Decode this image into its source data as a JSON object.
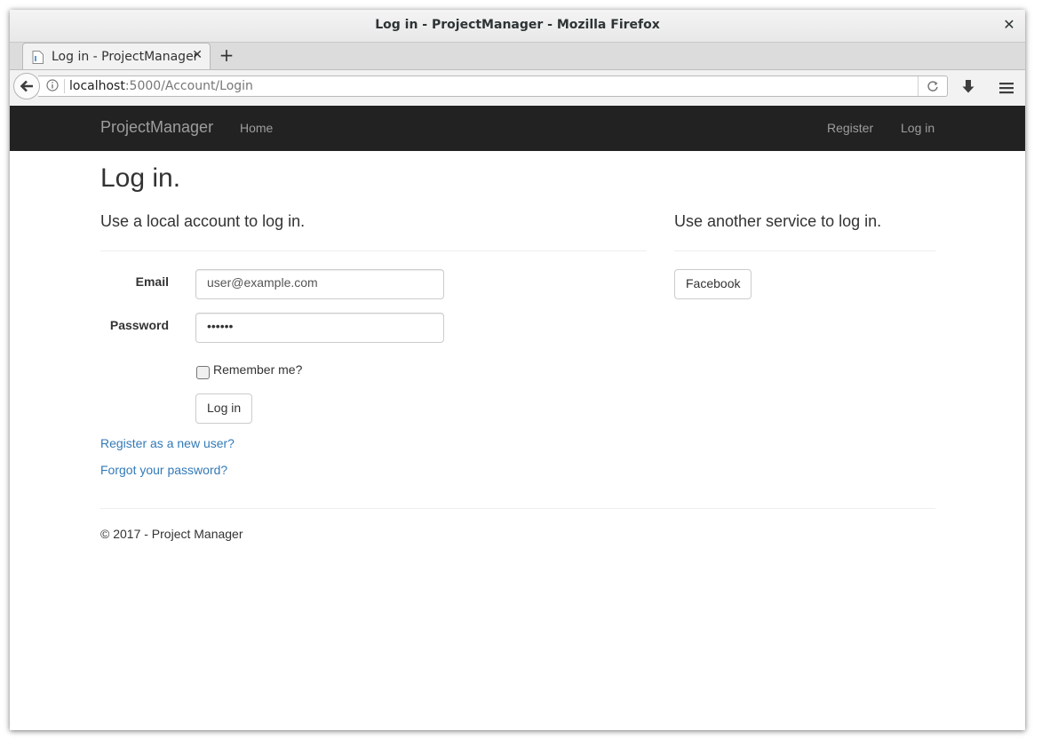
{
  "window": {
    "title": "Log in - ProjectManager - Mozilla Firefox",
    "close_glyph": "✕"
  },
  "tab": {
    "title": "Log in - ProjectManager",
    "close_glyph": "✕",
    "new_tab_glyph": "+"
  },
  "urlbar": {
    "host": "localhost",
    "path": ":5000/Account/Login"
  },
  "site_nav": {
    "brand": "ProjectManager",
    "home": "Home",
    "register": "Register",
    "login": "Log in",
    "background_color": "#222222",
    "link_color": "#9d9d9d"
  },
  "page": {
    "heading": "Log in.",
    "local_section_title": "Use a local account to log in.",
    "external_section_title": "Use another service to log in.",
    "email_label": "Email",
    "email_value": "user@example.com",
    "password_label": "Password",
    "password_value": "••••••",
    "remember_label": "Remember me?",
    "remember_checked": false,
    "login_button": "Log in",
    "register_link": "Register as a new user?",
    "forgot_link": "Forgot your password?",
    "facebook_button": "Facebook",
    "link_color": "#337ab7"
  },
  "footer": {
    "text": "© 2017 - Project Manager"
  },
  "icons": {
    "favicon": "page-icon",
    "back": "back-arrow-icon",
    "info": "info-icon",
    "reload": "reload-icon",
    "download": "download-icon",
    "menu": "hamburger-menu-icon"
  }
}
